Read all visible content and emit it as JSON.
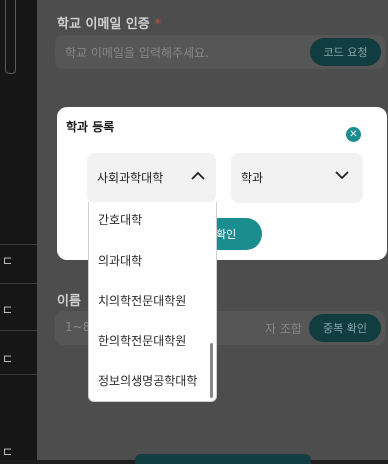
{
  "form": {
    "email_label": "학교 이메일 인증",
    "required_mark": "*",
    "email_placeholder": "학교 이메일을 입력해주세요.",
    "code_button": "코드 요청",
    "name_label": "이름",
    "name_placeholder_prefix": "1~8",
    "name_placeholder_suffix": "자 조합",
    "dup_check_button": "중복 확인"
  },
  "modal": {
    "title": "학과 등록",
    "college_select_value": "사회과학대학",
    "major_select_value": "학과",
    "confirm_label": "확인",
    "dropdown_options": [
      "간호대학",
      "의과대학",
      "치의학전문대학원",
      "한의학전문대학원",
      "정보의생명공학대학"
    ]
  },
  "sidebar": {
    "marks": [
      "⊏",
      "⊏",
      "⊏",
      "⊏"
    ]
  },
  "colors": {
    "accent": "#1c8d8f",
    "overlay_page": "#4d4d4d",
    "required": "#b34747"
  }
}
